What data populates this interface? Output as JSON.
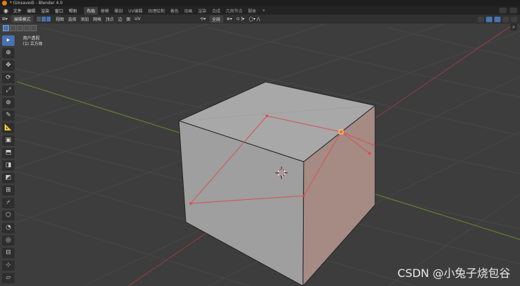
{
  "window": {
    "title": "* (Unsaved) - Blender 4.0"
  },
  "menu": {
    "items": [
      "文件",
      "编辑",
      "渲染",
      "窗口",
      "帮助"
    ],
    "workspaces": [
      "布局",
      "建模",
      "雕刻",
      "UV编辑",
      "纹理绘制",
      "着色",
      "动画",
      "渲染",
      "合成",
      "几何节点",
      "脚本"
    ],
    "add_tab": "+"
  },
  "header": {
    "mode": "编辑模式",
    "menus": [
      "视图",
      "选择",
      "添加",
      "网格",
      "顶点",
      "边",
      "面",
      "UV"
    ],
    "transform_orientation": "全局"
  },
  "viewport": {
    "view_label": "用户透视",
    "object_label": "(1) 立方体"
  },
  "colors": {
    "bg": "#3d3d3d",
    "grid": "#474747",
    "face": "#a3a3a3",
    "face_selected": "#a88e86",
    "x_axis": "#9a3c48",
    "y_axis": "#6e8b2e",
    "edge_selected": "#d4524f",
    "vertex_active": "#f07e10"
  },
  "watermark": "CSDN @小兔子烧包谷",
  "icons": {
    "toolbar": [
      "select-box-icon",
      "cursor-icon",
      "move-icon",
      "rotate-icon",
      "scale-icon",
      "transform-icon",
      "annotate-icon",
      "measure-icon",
      "add-cube-icon",
      "extrude-icon",
      "inset-icon",
      "bevel-icon",
      "loop-cut-icon",
      "knife-icon",
      "poly-build-icon",
      "spin-icon",
      "smooth-icon",
      "edge-slide-icon",
      "shrink-icon",
      "shear-icon"
    ]
  }
}
